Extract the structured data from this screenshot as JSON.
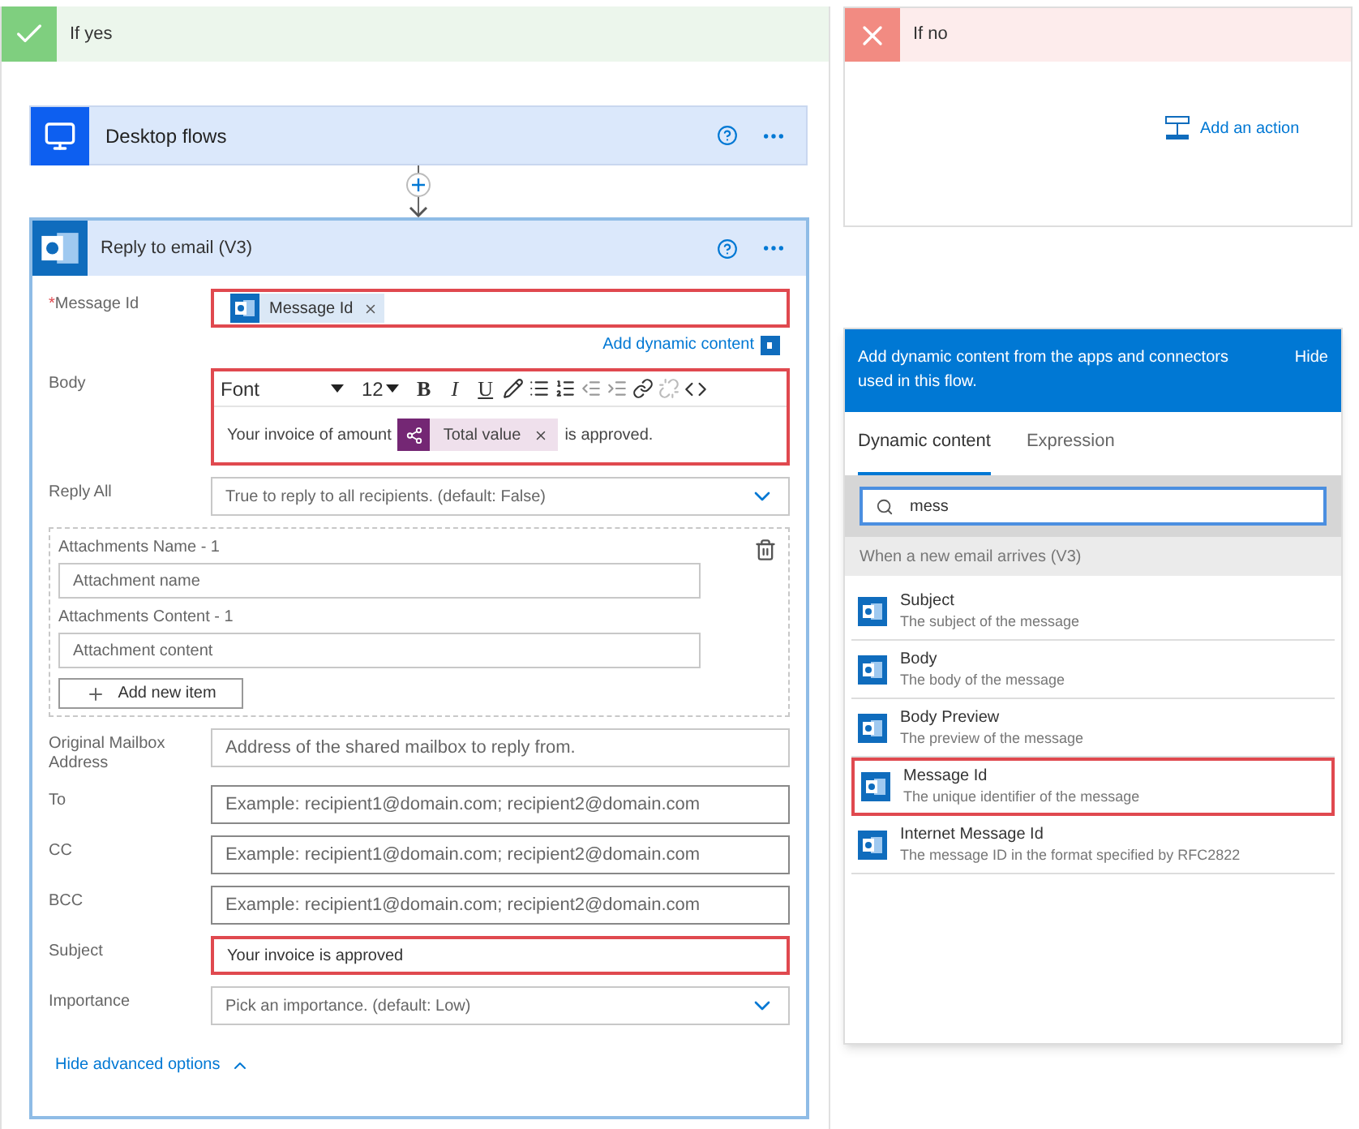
{
  "if_yes": {
    "title": "If yes"
  },
  "desktop_flows": {
    "title": "Desktop flows"
  },
  "reply_card": {
    "title": "Reply to email (V3)",
    "fields": [
      {
        "kind": "token",
        "marker": "*",
        "label": "Message Id",
        "token": "Message Id",
        "highlighted": true,
        "link": "Add dynamic content"
      },
      {
        "kind": "editor",
        "label": "Body",
        "font": "Font",
        "size": "12",
        "format_buttons": [
          "B",
          "I",
          "U"
        ],
        "before": "Your invoice of amount",
        "token": "Total value",
        "after": "is approved.",
        "highlighted": true
      },
      {
        "kind": "select",
        "label": "Reply All",
        "placeholder": "True to reply to all recipients. (default: False)",
        "highlighted": false
      },
      {
        "kind": "group",
        "items": [
          {
            "label": "Attachments Name - 1",
            "placeholder": "Attachment name"
          },
          {
            "label": "Attachments Content - 1",
            "placeholder": "Attachment content"
          }
        ],
        "button": "Add new item"
      },
      {
        "kind": "input",
        "label": "Original Mailbox Address",
        "placeholder": "Address of the shared mailbox to reply from.",
        "highlighted": false
      },
      {
        "kind": "input",
        "label": "To",
        "placeholder": "Example: recipient1@domain.com; recipient2@domain.com",
        "highlighted": false
      },
      {
        "kind": "input",
        "label": "CC",
        "placeholder": "Example: recipient1@domain.com; recipient2@domain.com",
        "highlighted": false
      },
      {
        "kind": "input",
        "label": "BCC",
        "placeholder": "Example: recipient1@domain.com; recipient2@domain.com",
        "highlighted": false
      },
      {
        "kind": "input",
        "label": "Subject",
        "value": "Your invoice is approved",
        "highlighted": true
      },
      {
        "kind": "select",
        "label": "Importance",
        "placeholder": "Pick an importance. (default: Low)",
        "highlighted": false
      }
    ],
    "footer_link": "Hide advanced options"
  },
  "if_no": {
    "title": "If no",
    "action": "Add an action"
  },
  "dynamic_panel": {
    "header": "Add dynamic content from the apps and connectors used in this flow.",
    "hide": "Hide",
    "tabs": [
      {
        "label": "Dynamic content",
        "selected": true
      },
      {
        "label": "Expression",
        "selected": false
      }
    ],
    "search": {
      "value": "mess"
    },
    "section": "When a new email arrives (V3)",
    "items": [
      {
        "title": "Subject",
        "description": "The subject of the message",
        "highlighted": false
      },
      {
        "title": "Body",
        "description": "The body of the message",
        "highlighted": false
      },
      {
        "title": "Body Preview",
        "description": "The preview of the message",
        "highlighted": false
      },
      {
        "title": "Message Id",
        "description": "The unique identifier of the message",
        "highlighted": true
      },
      {
        "title": "Internet Message Id",
        "description": "The message ID in the format specified by RFC2822",
        "highlighted": false
      }
    ]
  }
}
